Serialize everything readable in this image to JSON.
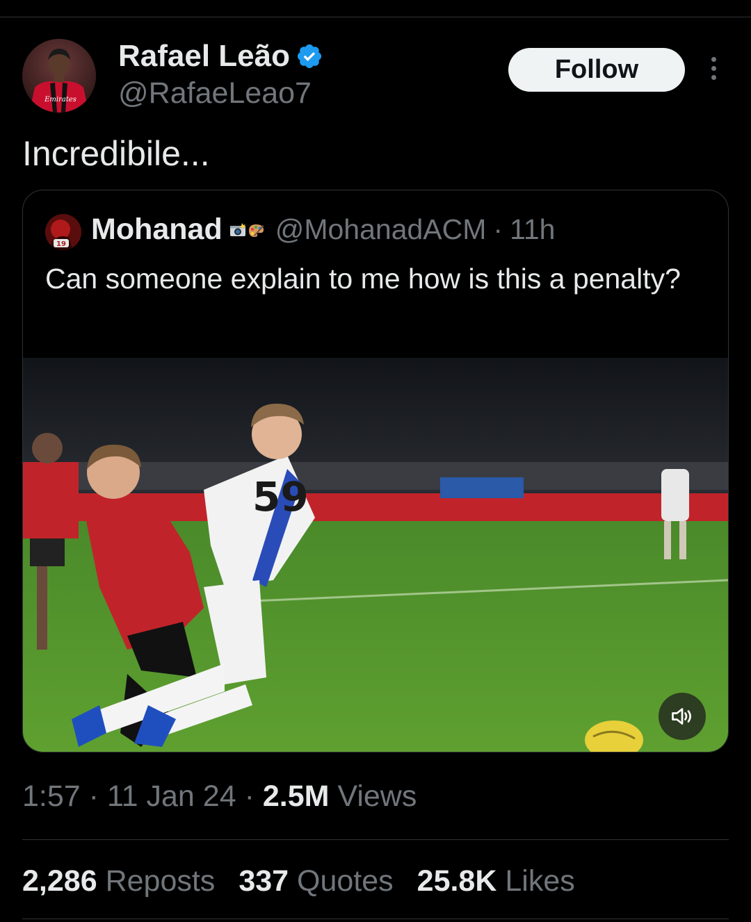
{
  "tweet": {
    "author": {
      "name": "Rafael Leão",
      "handle": "@RafaeLeao7",
      "verified": true,
      "avatar_icon": "player-avatar-image"
    },
    "follow_label": "Follow",
    "more_icon": "more-options-icon",
    "text": "Incredibile...",
    "quote": {
      "author_name": "Mohanad",
      "author_emojis": "camera-flash-emoji palette-emoji",
      "handle": "@MohanadACM",
      "separator": "·",
      "time": "11h",
      "text": "Can someone explain to me how is this a penalty?",
      "media_icon": "football-video-thumbnail",
      "sound_icon": "speaker-icon"
    },
    "meta": {
      "time": "1:57",
      "sep1": "·",
      "date": "11 Jan 24",
      "sep2": "·",
      "views_count": "2.5M",
      "views_label": "Views"
    },
    "stats": {
      "reposts_count": "2,286",
      "reposts_label": "Reposts",
      "quotes_count": "337",
      "quotes_label": "Quotes",
      "likes_count": "25.8K",
      "likes_label": "Likes"
    }
  },
  "colors": {
    "background": "#000000",
    "primary_text": "#e7e9ea",
    "secondary_text": "#71767b",
    "verified_blue": "#1d9bf0",
    "follow_bg": "#eff3f4"
  }
}
